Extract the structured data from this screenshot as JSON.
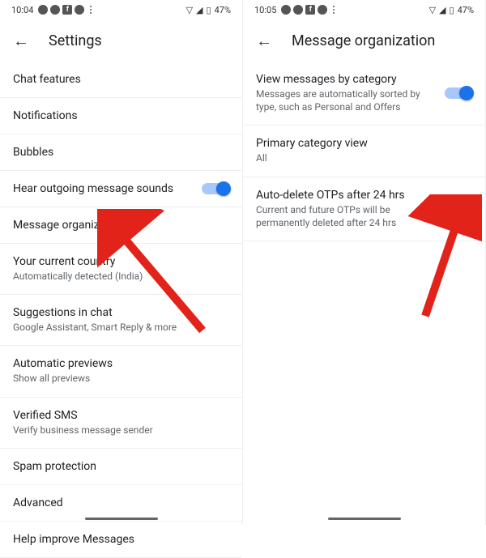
{
  "left": {
    "status": {
      "time": "10:04",
      "battery": "47%"
    },
    "title": "Settings",
    "items": [
      {
        "label": "Chat features"
      },
      {
        "label": "Notifications"
      },
      {
        "label": "Bubbles"
      },
      {
        "label": "Hear outgoing message sounds",
        "toggle": "on"
      },
      {
        "label": "Message organization"
      },
      {
        "label": "Your current country",
        "sub": "Automatically detected (India)"
      },
      {
        "label": "Suggestions in chat",
        "sub": "Google Assistant, Smart Reply & more"
      },
      {
        "label": "Automatic previews",
        "sub": "Show all previews"
      },
      {
        "label": "Verified SMS",
        "sub": "Verify business message sender"
      },
      {
        "label": "Spam protection"
      },
      {
        "label": "Advanced"
      },
      {
        "label": "Help improve Messages"
      }
    ]
  },
  "right": {
    "status": {
      "time": "10:05",
      "battery": "47%"
    },
    "title": "Message organization",
    "items": [
      {
        "label": "View messages by category",
        "sub": "Messages are automatically sorted by type, such as Personal and Offers",
        "toggle": "on"
      },
      {
        "label": "Primary category view",
        "sub": "All"
      },
      {
        "label": "Auto-delete OTPs after 24 hrs",
        "sub": "Current and future OTPs will be permanently deleted after 24 hrs",
        "toggle": "off"
      }
    ]
  }
}
